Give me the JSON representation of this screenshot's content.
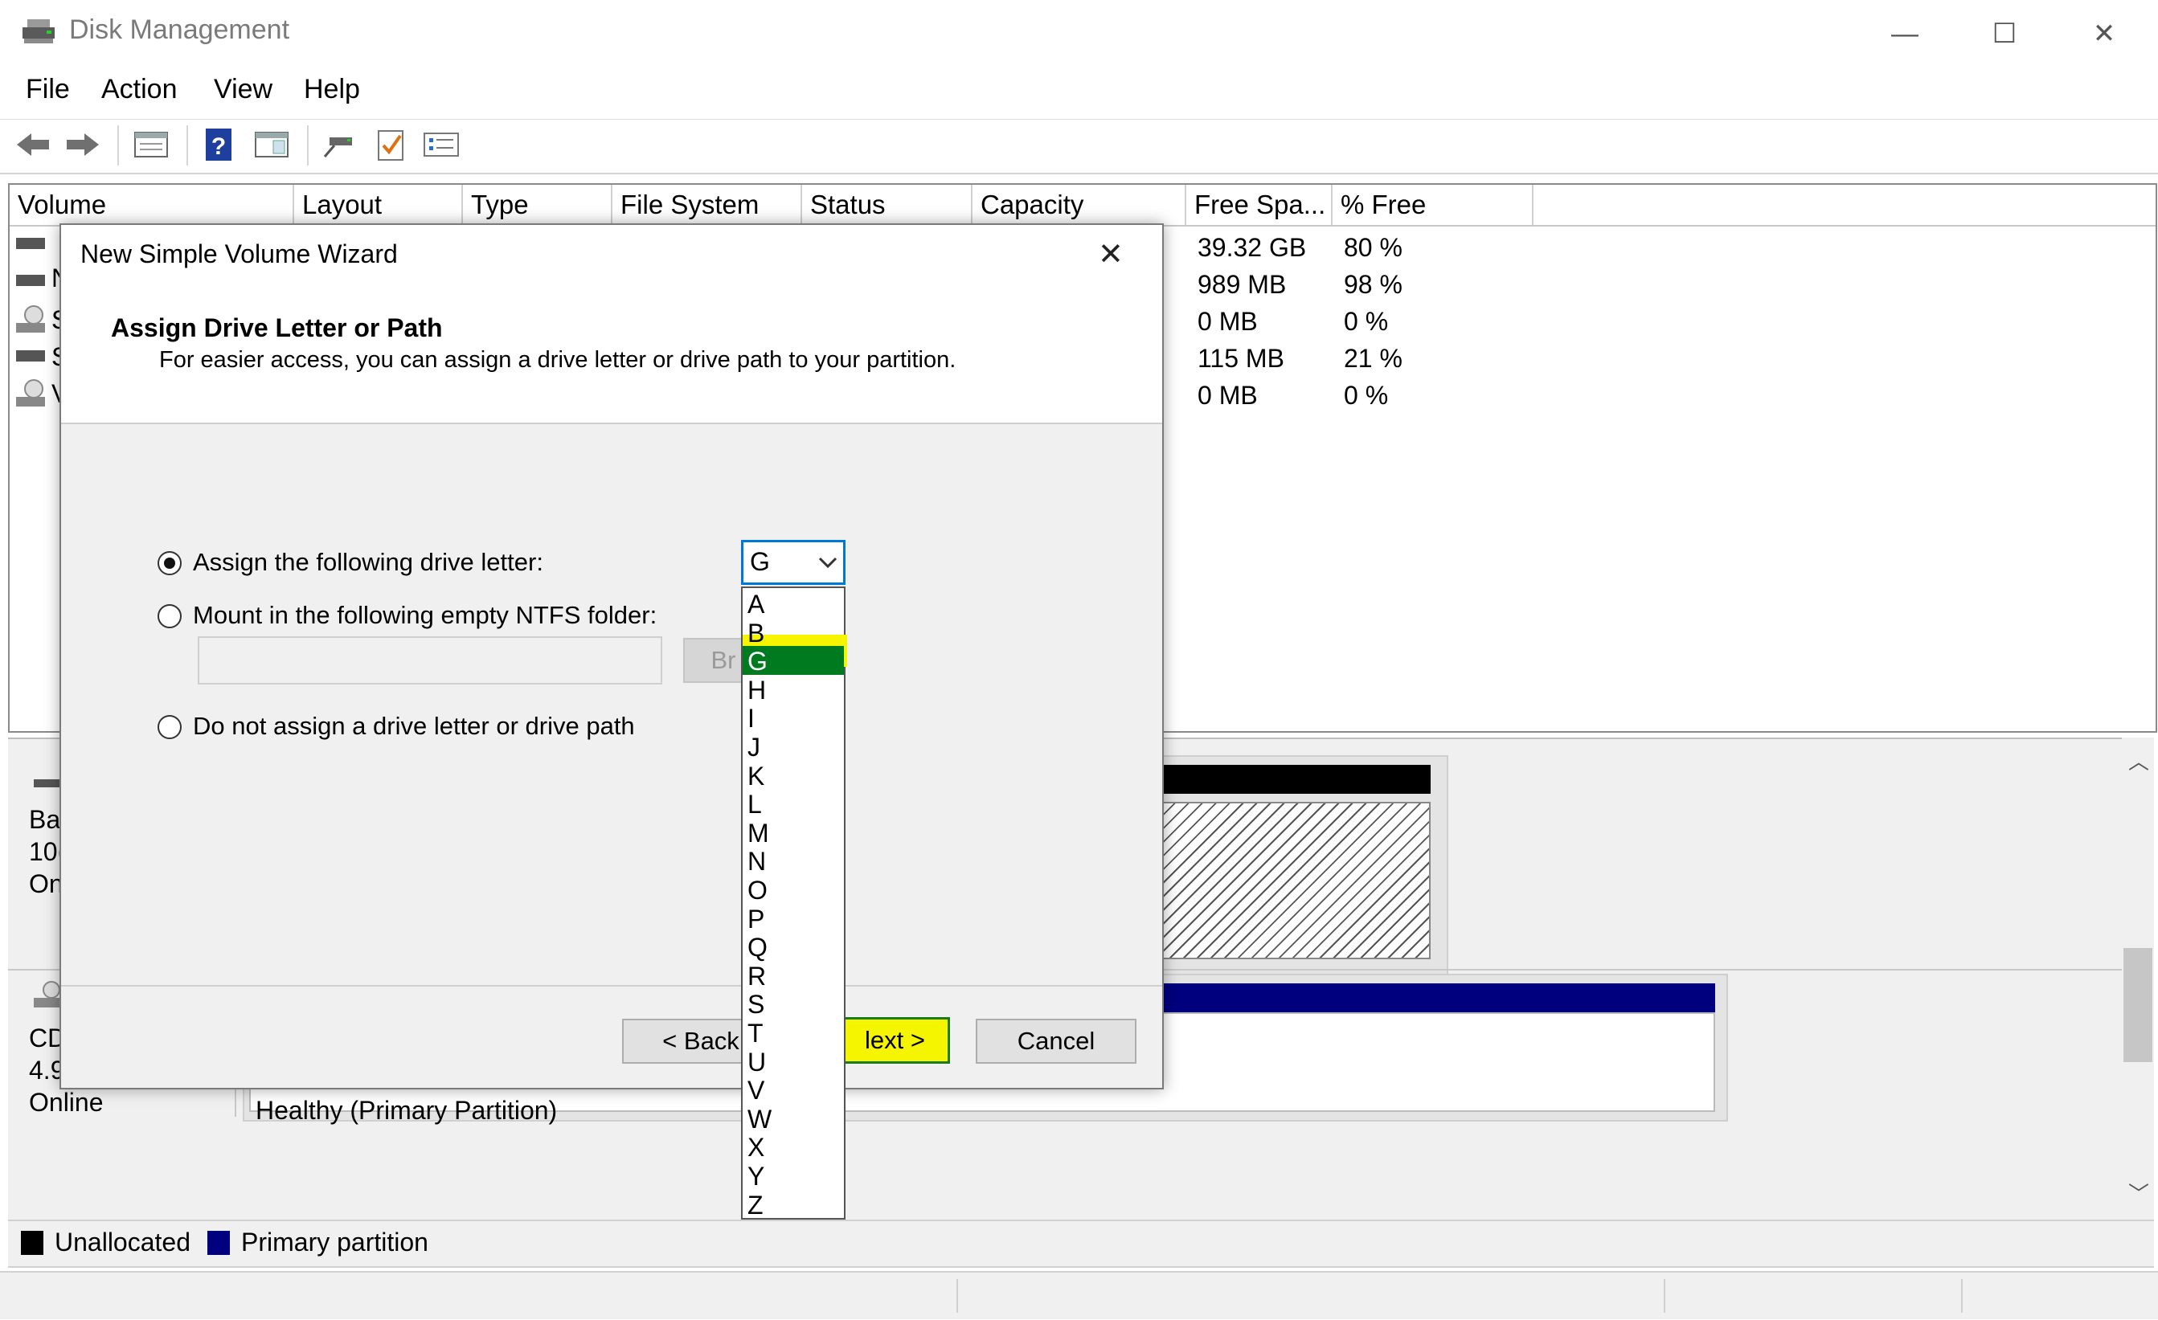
{
  "window": {
    "title": "Disk Management",
    "minimize": "—",
    "maximize": "☐",
    "close": "✕"
  },
  "menu": {
    "items": [
      "File",
      "Action",
      "View",
      "Help"
    ]
  },
  "toolbar": {
    "icons": [
      "back-icon",
      "forward-icon",
      "properties-icon",
      "help-icon",
      "show-hide-icon",
      "connect-icon",
      "checklist-icon",
      "settings-list-icon"
    ]
  },
  "volumes": {
    "columns": [
      "Volume",
      "Layout",
      "Type",
      "File System",
      "Status",
      "Capacity",
      "Free Spa...",
      "% Free"
    ],
    "rows": [
      {
        "free": "39.32 GB",
        "pct": "80 %"
      },
      {
        "free": "989 MB",
        "pct": "98 %"
      },
      {
        "free": "0 MB",
        "pct": "0 %"
      },
      {
        "free": "115 MB",
        "pct": "21 %"
      },
      {
        "free": "0 MB",
        "pct": "0 %"
      }
    ],
    "row_prefixes": [
      "",
      "N",
      "S",
      "S",
      "V"
    ]
  },
  "disks": {
    "disk0": {
      "line1": "Ba",
      "line2": "10(",
      "line3": "On"
    },
    "cdrom": {
      "line1": "CD",
      "line2": "4.9",
      "line3": "Online",
      "partition_status": "Healthy (Primary Partition)"
    }
  },
  "legend": {
    "unallocated": "Unallocated",
    "primary": "Primary partition",
    "colors": {
      "unallocated": "#000000",
      "primary": "#00007f"
    }
  },
  "wizard": {
    "title": "New Simple Volume Wizard",
    "close": "✕",
    "heading": "Assign Drive Letter or Path",
    "subheading": "For easier access, you can assign a drive letter or drive path to your partition.",
    "option_assign": "Assign the following drive letter:",
    "option_mount": "Mount in the following empty NTFS folder:",
    "option_none": "Do not assign a drive letter or drive path",
    "browse": "Br",
    "selected_letter": "G",
    "letters": [
      "A",
      "B",
      "G",
      "H",
      "I",
      "J",
      "K",
      "L",
      "M",
      "N",
      "O",
      "P",
      "Q",
      "R",
      "S",
      "T",
      "U",
      "V",
      "W",
      "X",
      "Y",
      "Z"
    ],
    "back": "< Back",
    "next": "lext >",
    "cancel": "Cancel",
    "highlight_colors": {
      "selected": "#007a1e",
      "marker": "#f5f500"
    }
  }
}
